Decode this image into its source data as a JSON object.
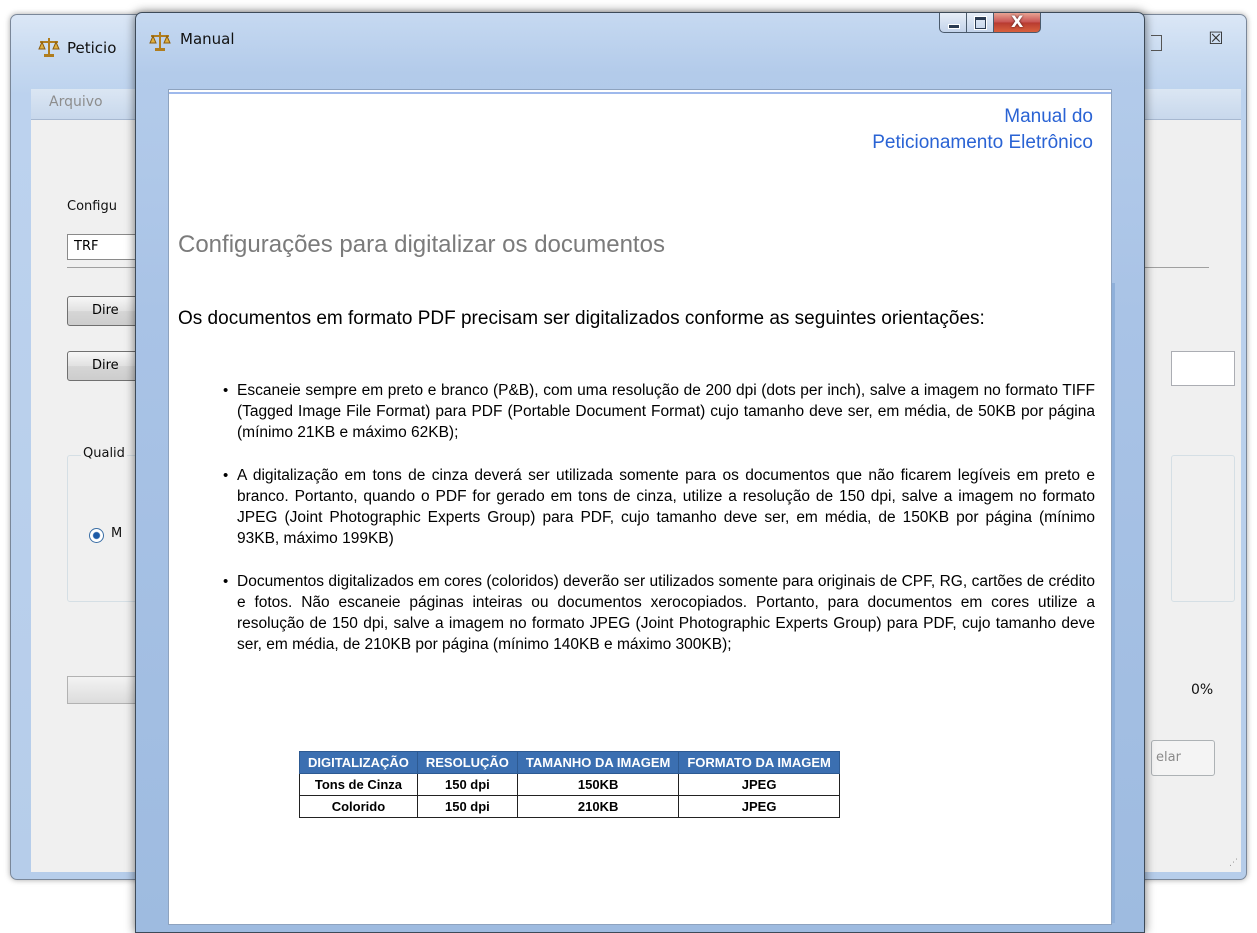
{
  "background_window": {
    "title": "Peticio",
    "menu_first": "Arquivo",
    "config_label": "Configu",
    "combo_value": "TRF",
    "button_1": "Dire",
    "button_2": "Dire",
    "group_label": "Qualid",
    "radio_label": "M",
    "progress_percent": "0%",
    "cancel_fragment": "elar"
  },
  "manual_window": {
    "title": "Manual",
    "controls": {
      "minimize": "minimize-icon",
      "maximize": "maximize-icon",
      "close": "close-icon"
    },
    "header_line1": "Manual do",
    "header_line2": "Peticionamento Eletrônico",
    "section_title": "Configurações para digitalizar os documentos",
    "intro": "Os documentos em formato PDF precisam ser digitalizados conforme as seguintes orientações:",
    "bullets": [
      " Escaneie sempre em preto e branco (P&B), com uma resolução de 200 dpi (dots per inch), salve a imagem no formato TIFF (Tagged Image File Format) para PDF (Portable Document Format) cujo tamanho deve ser, em média, de 50KB por página (mínimo 21KB e máximo 62KB);",
      "A digitalização em tons de cinza deverá ser utilizada somente para os documentos que não ficarem legíveis em preto e branco. Portanto, quando o PDF for gerado em tons de cinza, utilize a resolução de 150 dpi, salve a imagem no formato JPEG (Joint Photographic Experts Group) para PDF, cujo tamanho deve ser, em média, de 150KB por página (mínimo 93KB, máximo 199KB)",
      "Documentos digitalizados em cores (coloridos) deverão ser utilizados somente para originais de CPF, RG, cartões de crédito e fotos. Não escaneie páginas inteiras ou documentos xerocopiados. Portanto, para documentos em cores utilize a resolução de 150 dpi, salve a imagem no formato JPEG (Joint Photographic Experts Group) para PDF, cujo tamanho deve ser, em média, de 210KB por página (mínimo 140KB e máximo 300KB);"
    ],
    "table": {
      "headers": [
        "DIGITALIZAÇÃO",
        "RESOLUÇÃO",
        "TAMANHO DA IMAGEM",
        "FORMATO DA IMAGEM"
      ],
      "rows": [
        [
          "Tons de Cinza",
          "150 dpi",
          "150KB",
          "JPEG"
        ],
        [
          "Colorido",
          "150 dpi",
          "210KB",
          "JPEG"
        ]
      ]
    }
  },
  "colors": {
    "header_blue": "#2a63d4",
    "table_header_bg": "#3b6fb1",
    "section_gray": "#7b7b7b"
  }
}
